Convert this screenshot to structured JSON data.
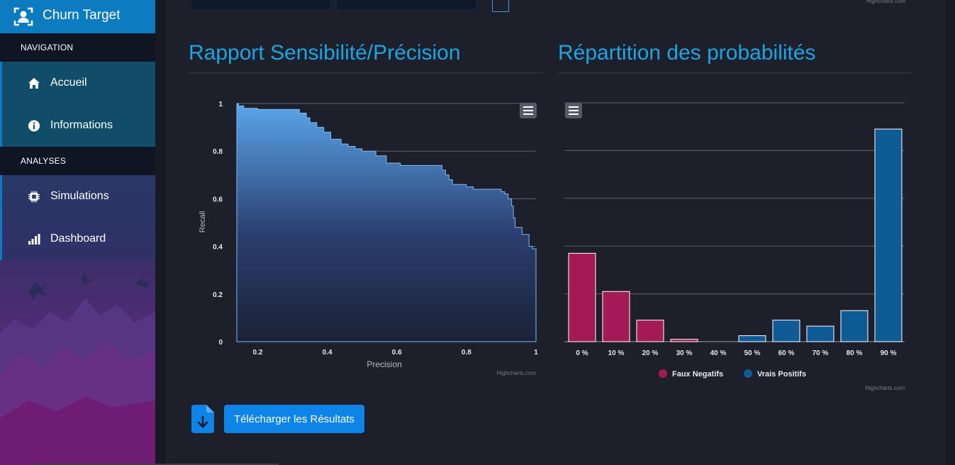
{
  "app": {
    "title": "Churn Target"
  },
  "sidebar": {
    "sections": [
      {
        "title": "NAVIGATION",
        "items": [
          {
            "label": "Accueil",
            "icon": "home-icon"
          },
          {
            "label": "Informations",
            "icon": "info-icon"
          }
        ]
      },
      {
        "title": "ANALYSES",
        "items": [
          {
            "label": "Simulations",
            "icon": "chip-icon"
          },
          {
            "label": "Dashboard",
            "icon": "bar-chart-icon"
          }
        ]
      }
    ]
  },
  "credit": "Highcharts.com",
  "download": {
    "label": "Télécharger les Résultats",
    "icon": "file-download-icon"
  },
  "colors": {
    "accent": "#1aa6e0",
    "brand": "#0c7bc0",
    "faux_negatifs": "#a31a56",
    "vrais_positifs": "#0e5b95"
  },
  "chart_data": [
    {
      "type": "area",
      "title": "Rapport Sensibilité/Précision",
      "xlabel": "Precision",
      "ylabel": "Recall",
      "xlim": [
        0.14,
        1.0
      ],
      "ylim": [
        0,
        1
      ],
      "x_ticks": [
        "0.2",
        "0.4",
        "0.6",
        "0.8",
        "1"
      ],
      "y_ticks": [
        "0",
        "0.2",
        "0.4",
        "0.6",
        "0.8",
        "1"
      ],
      "x": [
        0.14,
        0.145,
        0.16,
        0.2,
        0.3,
        0.32,
        0.34,
        0.35,
        0.37,
        0.39,
        0.41,
        0.44,
        0.46,
        0.48,
        0.5,
        0.54,
        0.57,
        0.61,
        0.63,
        0.66,
        0.69,
        0.73,
        0.74,
        0.75,
        0.76,
        0.8,
        0.82,
        0.85,
        0.88,
        0.9,
        0.91,
        0.92,
        0.93,
        0.935,
        0.94,
        0.96,
        0.98,
        0.99,
        1.0
      ],
      "y": [
        1.0,
        0.99,
        0.98,
        0.975,
        0.975,
        0.96,
        0.94,
        0.92,
        0.9,
        0.88,
        0.85,
        0.83,
        0.82,
        0.81,
        0.8,
        0.78,
        0.75,
        0.74,
        0.74,
        0.74,
        0.74,
        0.72,
        0.7,
        0.68,
        0.66,
        0.65,
        0.64,
        0.64,
        0.64,
        0.63,
        0.62,
        0.6,
        0.57,
        0.52,
        0.48,
        0.45,
        0.4,
        0.39,
        0.0
      ],
      "grid": true
    },
    {
      "type": "bar",
      "title": "Répartition des probabilités",
      "categories": [
        "0 %",
        "10 %",
        "20 %",
        "30 %",
        "40 %",
        "50 %",
        "60 %",
        "70 %",
        "80 %",
        "90 %"
      ],
      "series": [
        {
          "name": "Faux Negatifs",
          "values": [
            0.37,
            0.21,
            0.09,
            0.01,
            0,
            0,
            0,
            0,
            0,
            0
          ]
        },
        {
          "name": "Vrais Positifs",
          "values": [
            0,
            0,
            0,
            0,
            0,
            0.025,
            0.09,
            0.065,
            0.13,
            0.89
          ]
        }
      ],
      "ylim": [
        0,
        1
      ],
      "legend": "bottom-center",
      "grid": true
    }
  ]
}
